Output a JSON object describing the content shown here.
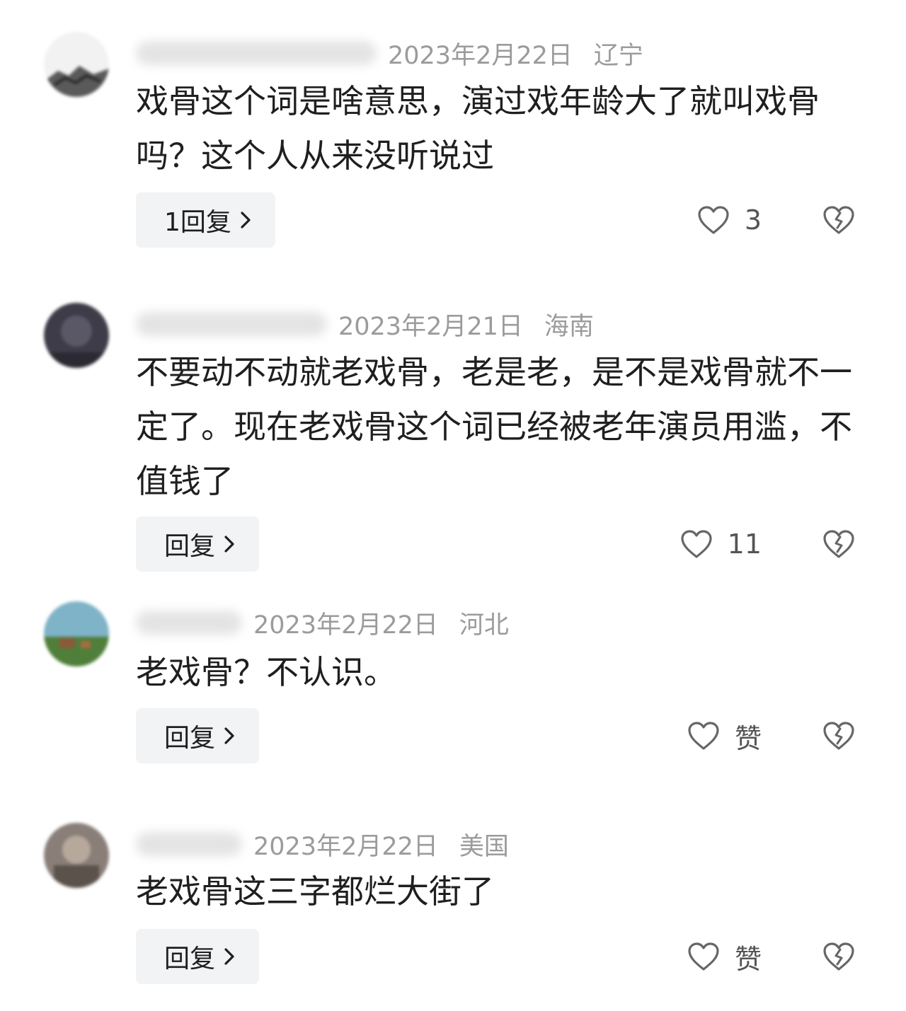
{
  "comments": [
    {
      "date": "2023年2月22日",
      "region": "辽宁",
      "text": "戏骨这个词是啥意思，演过戏年龄大了就叫戏骨吗？这个人从来没听说过",
      "reply_label": "1回复",
      "like_count": "3"
    },
    {
      "date": "2023年2月21日",
      "region": "海南",
      "text": "不要动不动就老戏骨，老是老，是不是戏骨就不一定了。现在老戏骨这个词已经被老年演员用滥，不值钱了",
      "reply_label": "回复",
      "like_count": "11"
    },
    {
      "date": "2023年2月22日",
      "region": "河北",
      "text": "老戏骨？不认识。",
      "reply_label": "回复",
      "like_count": "赞"
    },
    {
      "date": "2023年2月22日",
      "region": "美国",
      "text": "老戏骨这三字都烂大街了",
      "reply_label": "回复",
      "like_count": "赞"
    }
  ],
  "icons": {
    "like": "heart-outline-icon",
    "dislike": "broken-heart-icon",
    "reply_arrow": "chevron-right-icon"
  },
  "colors": {
    "text": "#1f1f1f",
    "meta": "#9b9b9b",
    "reply_bg": "#f2f3f5",
    "icon": "#666666"
  }
}
